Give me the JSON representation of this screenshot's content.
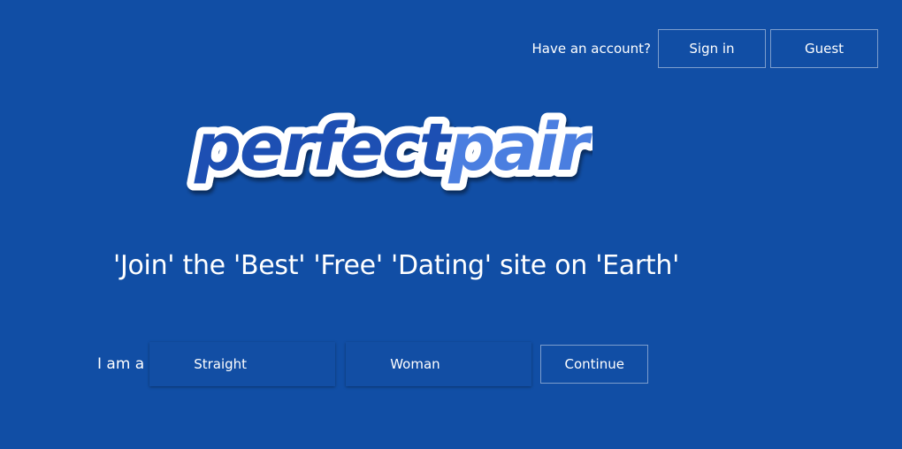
{
  "header": {
    "have_account_text": "Have an account?",
    "signin_label": "Sign in",
    "guest_label": "Guest"
  },
  "logo": {
    "part1": "perfect",
    "part2": "pair",
    "part1_color": "#1d4fb3",
    "part2_color": "#4a7ee0"
  },
  "tagline": "'Join' the 'Best' 'Free' 'Dating' site on 'Earth'",
  "signup": {
    "prefix_label": "I am a",
    "orientation_value": "Straight",
    "gender_value": "Woman",
    "continue_label": "Continue"
  },
  "colors": {
    "background": "#114ea5",
    "text": "#ffffff"
  }
}
